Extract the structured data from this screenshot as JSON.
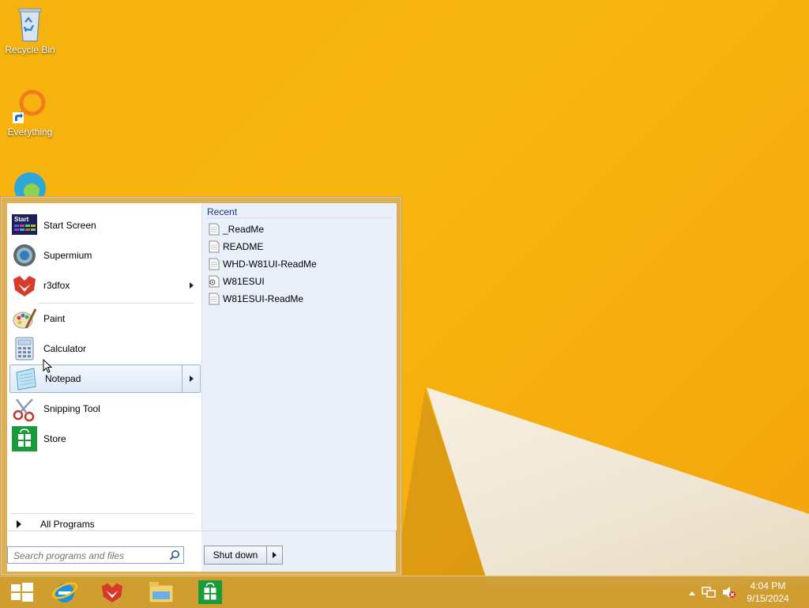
{
  "desktop": {
    "icons": [
      {
        "label": "Recycle Bin",
        "icon": "recycle-bin-icon"
      },
      {
        "label": "Everything",
        "icon": "everything-search-icon"
      },
      {
        "label": "",
        "icon": "edge-icon"
      }
    ]
  },
  "start_menu": {
    "pinned": [
      {
        "label": "Start Screen",
        "icon": "start-screen-icon",
        "has_submenu": false
      },
      {
        "label": "Supermium",
        "icon": "supermium-icon",
        "has_submenu": false
      },
      {
        "label": "r3dfox",
        "icon": "r3dfox-icon",
        "has_submenu": true
      }
    ],
    "programs": [
      {
        "label": "Paint",
        "icon": "paint-icon",
        "has_submenu": false
      },
      {
        "label": "Calculator",
        "icon": "calculator-icon",
        "has_submenu": false
      },
      {
        "label": "Notepad",
        "icon": "notepad-icon",
        "has_submenu": true,
        "highlighted": true
      },
      {
        "label": "Snipping Tool",
        "icon": "snipping-tool-icon",
        "has_submenu": false
      },
      {
        "label": "Store",
        "icon": "store-icon",
        "has_submenu": false
      }
    ],
    "all_programs_label": "All Programs",
    "recent": {
      "header": "Recent",
      "items": [
        {
          "label": "_ReadMe",
          "icon": "text-file-icon"
        },
        {
          "label": "README",
          "icon": "text-file-icon"
        },
        {
          "label": "WHD-W81UI-ReadMe",
          "icon": "text-file-icon"
        },
        {
          "label": "W81ESUI",
          "icon": "script-file-icon"
        },
        {
          "label": "W81ESUI-ReadMe",
          "icon": "text-file-icon"
        }
      ]
    },
    "search": {
      "placeholder": "Search programs and files",
      "value": ""
    },
    "shutdown_label": "Shut down"
  },
  "taskbar": {
    "apps": [
      "start-button",
      "internet-explorer-icon",
      "r3dfox-icon",
      "file-explorer-icon",
      "store-icon"
    ],
    "clock": {
      "time": "4:04 PM",
      "date": "9/15/2024"
    }
  },
  "colors": {
    "wallpaper": "#f6b20e",
    "taskbar": "#ce9c34",
    "recent_header": "#1e3287"
  }
}
